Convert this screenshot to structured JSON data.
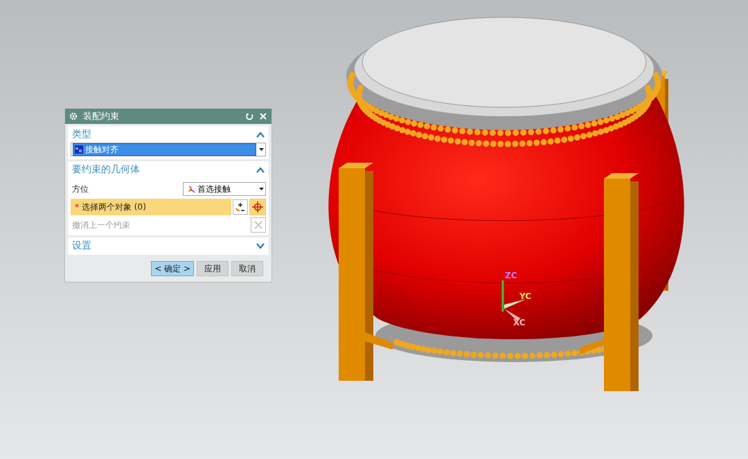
{
  "dialog": {
    "title": "装配约束",
    "sections": [
      {
        "kind": "type",
        "title": "类型",
        "expanded": true,
        "dropdown": {
          "value": "接触对齐"
        }
      },
      {
        "kind": "geometry",
        "title": "要约束的几何体",
        "expanded": true,
        "orientation": {
          "label": "方位",
          "value": "首选接触"
        },
        "selection": {
          "mark": "*",
          "label": "选择两个对象 (0)"
        },
        "undo": {
          "label": "撤消上一个约束",
          "disabled": true
        }
      },
      {
        "kind": "settings",
        "title": "设置",
        "expanded": false
      }
    ],
    "buttons": [
      {
        "label": "< 确定 >",
        "selected": true
      },
      {
        "label": "应用",
        "selected": false
      },
      {
        "label": "取消",
        "selected": false
      }
    ]
  },
  "viewport": {
    "axes": [
      {
        "label": "ZC",
        "color": "#c080ff"
      },
      {
        "label": "YC",
        "color": "#ffe060"
      },
      {
        "label": "XC",
        "color": "#ffb8b8"
      }
    ]
  }
}
